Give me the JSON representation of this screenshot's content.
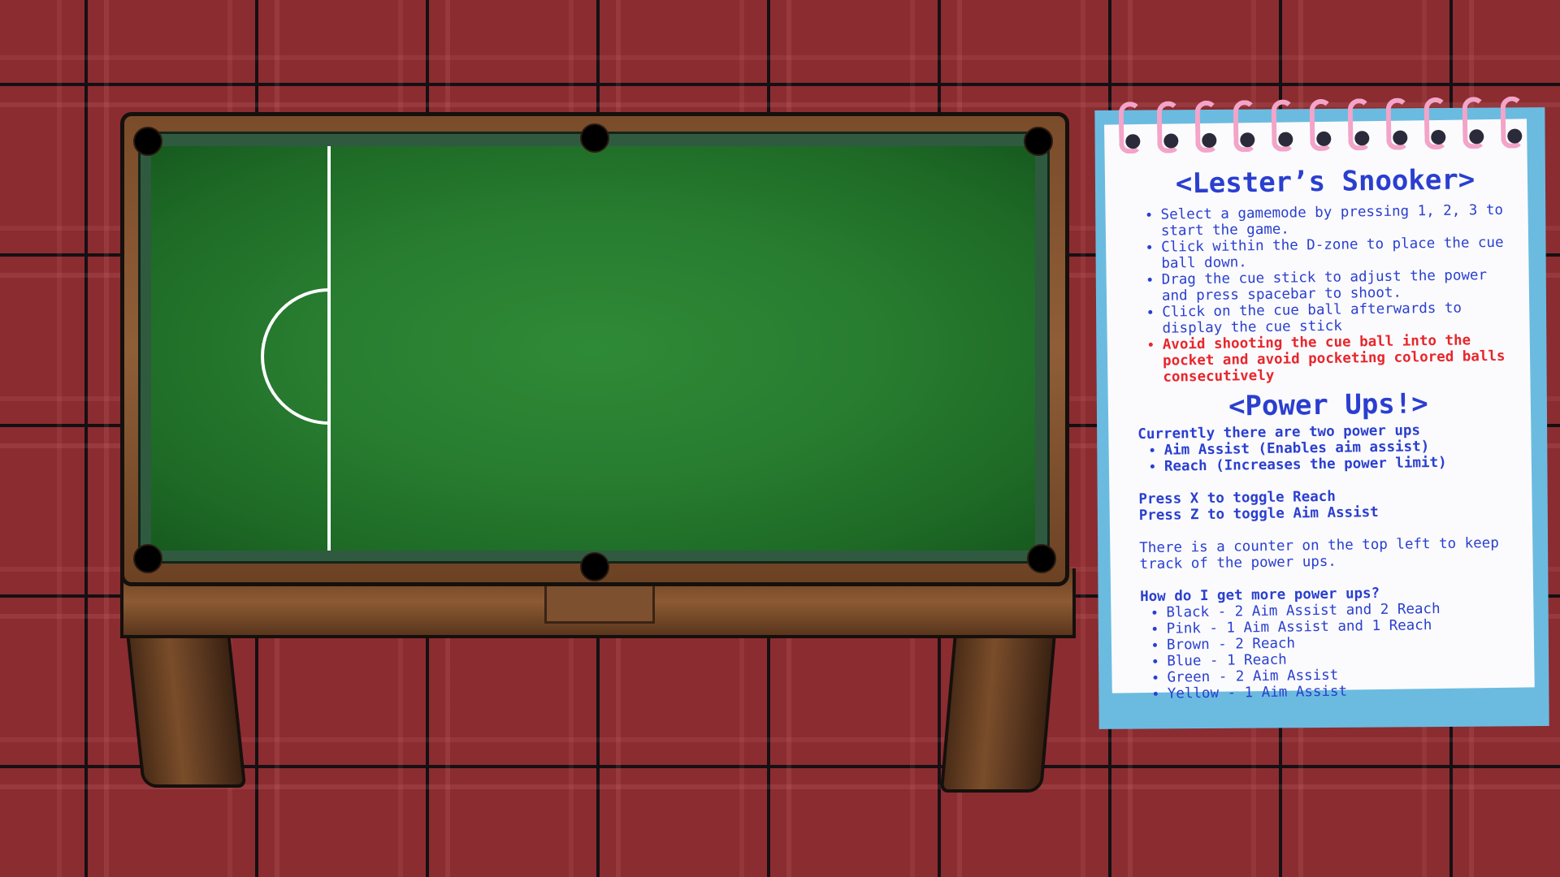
{
  "colors": {
    "background": "#8b2c31",
    "felt": "#287d30",
    "notebook_border": "#6bbbe0",
    "text": "#2a3fcf",
    "warning": "#e8262b",
    "rings": "#f3a4c8"
  },
  "instructions": {
    "title": "<Lester’s Snooker>",
    "items": [
      "Select a gamemode by pressing 1, 2, 3 to start the game.",
      "Click within the D-zone to place the cue ball down.",
      "Drag the cue stick to adjust the power and press spacebar to shoot.",
      "Click on the cue ball afterwards to display the cue stick"
    ],
    "warning": "Avoid shooting the cue ball into the pocket and avoid pocketing colored balls consecutively"
  },
  "powerups": {
    "title": "<Power Ups!>",
    "intro": "Currently there are two power ups",
    "list": [
      "Aim Assist (Enables aim assist)",
      "Reach (Increases the power limit)"
    ],
    "toggle_x": "Press X to toggle Reach",
    "toggle_z": "Press Z to toggle Aim Assist",
    "counter_note": "There is a counter on the top left to keep track of the power ups.",
    "how_title": "How do I get more power ups?",
    "rewards": [
      "Black - 2 Aim Assist and 2 Reach",
      "Pink - 1 Aim Assist and 1 Reach",
      "Brown - 2 Reach",
      "Blue - 1 Reach",
      "Green - 2 Aim Assist",
      "Yellow - 1 Aim Assist"
    ]
  }
}
